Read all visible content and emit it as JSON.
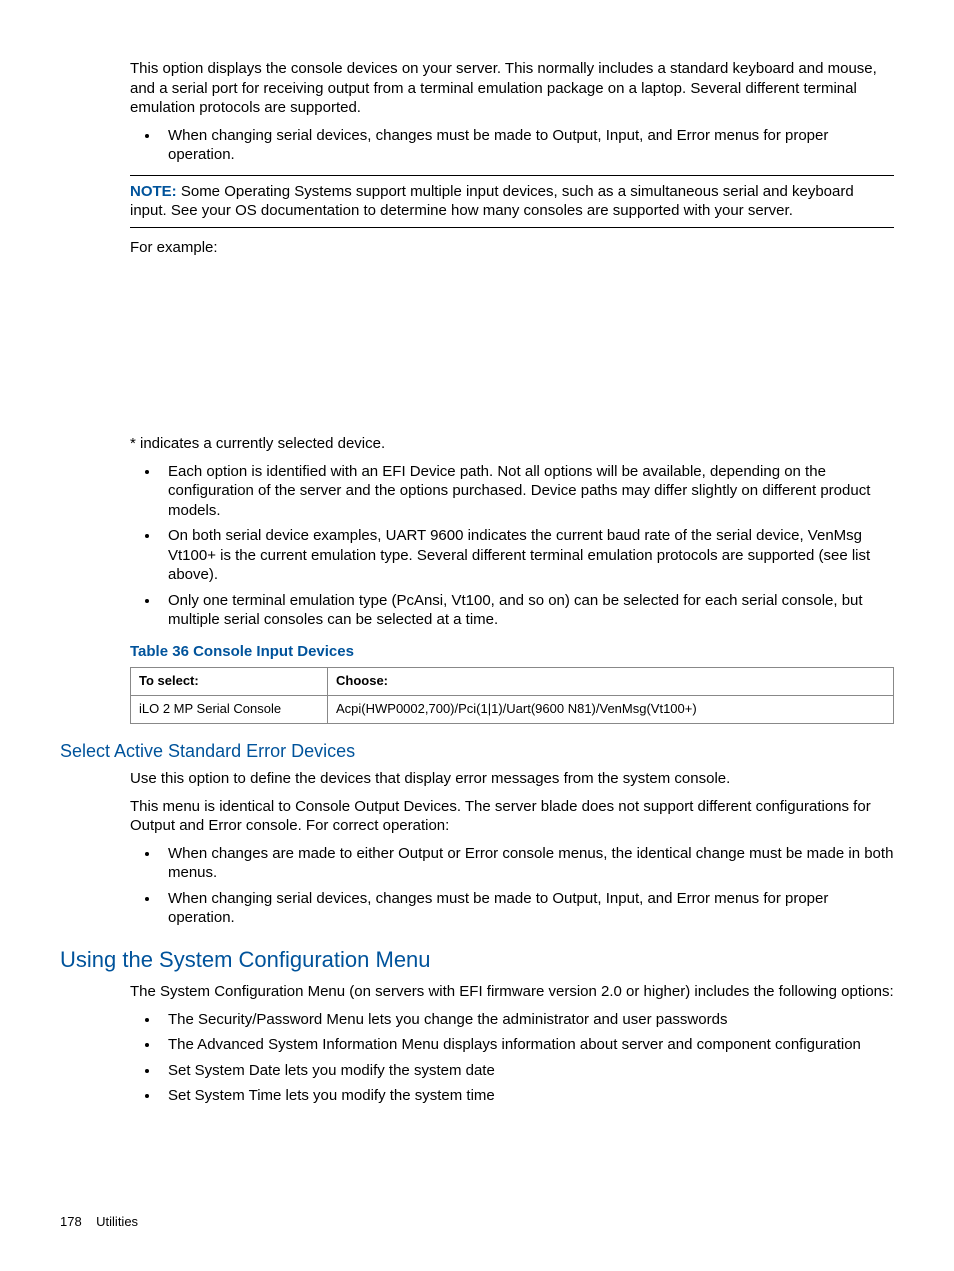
{
  "intro": {
    "p1": "This option displays the console devices on your server. This normally includes a standard keyboard and mouse, and a serial port for receiving output from a terminal emulation package on a laptop. Several different terminal emulation protocols are supported.",
    "bullet1": "When changing serial devices, changes must be made to Output, Input, and Error menus for proper operation."
  },
  "note": {
    "label": "NOTE:",
    "text": "Some Operating Systems support multiple input devices, such as a simultaneous serial and keyboard input. See your OS documentation to determine how many consoles are supported with your server."
  },
  "example_lead": "For example:",
  "asterisk_note": "* indicates a currently selected device.",
  "bullets2": [
    "Each option is identified with an EFI Device path. Not all options will be available, depending on the configuration of the server and the options purchased. Device paths may differ slightly on different product models.",
    "On both serial device examples, UART 9600 indicates the current baud rate of the serial device, VenMsg Vt100+ is the current emulation type. Several different terminal emulation protocols are supported (see list above).",
    "Only one terminal emulation type (PcAnsi, Vt100, and so on) can be selected for each serial console, but multiple serial consoles can be selected at a time."
  ],
  "table": {
    "caption": "Table 36 Console Input Devices",
    "headers": [
      "To select:",
      "Choose:"
    ],
    "rows": [
      [
        "iLO 2 MP Serial Console",
        "Acpi(HWP0002,700)/Pci(1|1)/Uart(9600 N81)/VenMsg(Vt100+)"
      ]
    ]
  },
  "error_devices": {
    "title": "Select Active Standard Error Devices",
    "p1": "Use this option to define the devices that display error messages from the system console.",
    "p2": "This menu is identical to Console Output Devices. The server blade does not support different configurations for Output and Error console. For correct operation:",
    "bullets": [
      "When changes are made to either Output or Error console menus, the identical change must be made in both menus.",
      "When changing serial devices, changes must be made to Output, Input, and Error menus for proper operation."
    ]
  },
  "sysconfig": {
    "title": "Using the System Configuration Menu",
    "p1": "The System Configuration Menu (on servers with EFI firmware version 2.0 or higher) includes the following options:",
    "bullets": [
      "The Security/Password Menu lets you change the administrator and user passwords",
      "The Advanced System Information Menu displays information about server and component configuration",
      "Set System Date lets you modify the system date",
      "Set System Time lets you modify the system time"
    ]
  },
  "footer": {
    "page": "178",
    "section": "Utilities"
  }
}
